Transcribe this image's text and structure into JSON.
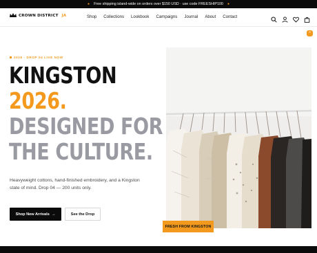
{
  "announcement": {
    "text": "Free shipping island-wide on orders over $150 USD · use code FREESHIP100"
  },
  "brand": {
    "name": "CROWN DISTRICT",
    "suffix": "JA"
  },
  "nav": {
    "items": [
      "Shop",
      "Collections",
      "Lookbook",
      "Campaigns",
      "Journal",
      "About",
      "Contact"
    ]
  },
  "header_icons": {
    "search": "search-icon",
    "account": "user-icon",
    "wishlist": "heart-icon",
    "cart": "bag-icon",
    "cart_count": "0"
  },
  "hero": {
    "eyebrow": "2026 · DROP 04 LIVE NOW",
    "headline": [
      "KINGSTON",
      "2026.",
      "DESIGNED FOR",
      "THE CULTURE."
    ],
    "description": "Heavyweight cottons, hand-finished embroidery, and a Kingston state of mind. Drop 04 — 200 units only.",
    "primary_cta": "Shop New Arrivals",
    "secondary_cta": "See the Drop",
    "image_badge": "FRESH FROM KINGSTON"
  },
  "colors": {
    "accent": "#f39a1e",
    "dark": "#0b0b0b",
    "muted": "#9a9aa2"
  }
}
